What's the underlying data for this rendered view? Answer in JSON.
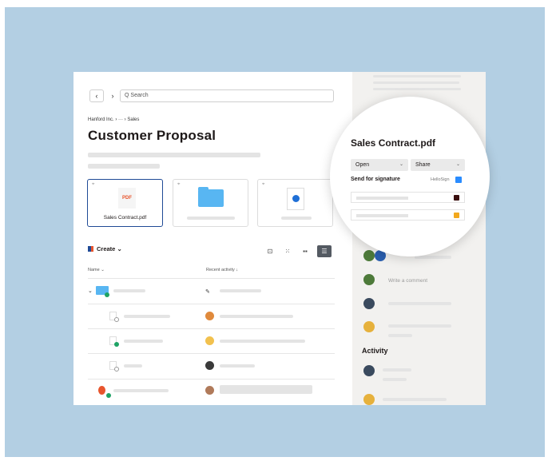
{
  "nav": {
    "back_icon": "‹",
    "forward_icon": "›"
  },
  "search": {
    "icon": "Q",
    "placeholder": "Search"
  },
  "breadcrumb": "Hanford Inc. › ··· › Sales",
  "page_title": "Customer Proposal",
  "tiles": [
    {
      "badge": "PDF",
      "label": "Sales Contract.pdf"
    }
  ],
  "toolbar": {
    "create_label": "Create",
    "create_caret": "⌄"
  },
  "columns": {
    "name": "Name ⌄",
    "recent_activity": "Recent activity ↓"
  },
  "panel": {
    "file_title": "Sales Contract.pdf",
    "open_label": "Open",
    "share_label": "Share",
    "caret": "⌄",
    "send_for_signature": "Send for signature",
    "hellosign": "HelloSign",
    "comment_placeholder": "Write a comment",
    "activity_heading": "Activity"
  },
  "colors": {
    "accent": "#1f4a96",
    "folder": "#58b6f2",
    "background": "#b3cfe3",
    "success": "#1ea365",
    "pdf": "#e8552d"
  }
}
